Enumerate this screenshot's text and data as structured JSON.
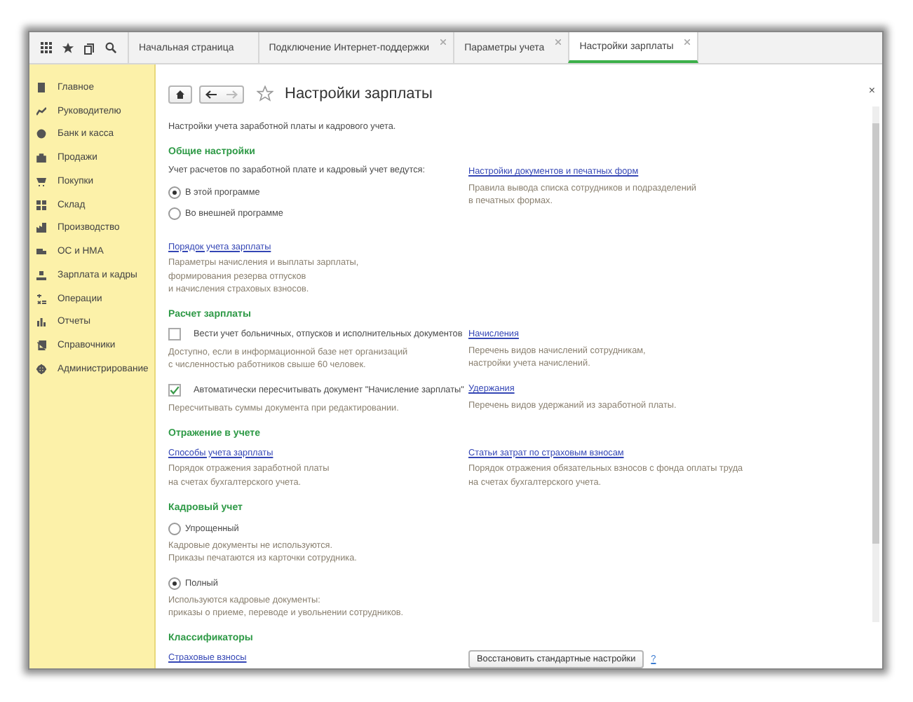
{
  "tabs": [
    {
      "label": "Начальная страница",
      "closable": false,
      "selected": false
    },
    {
      "label": "Подключение Интернет-поддержки",
      "closable": true,
      "selected": false
    },
    {
      "label": "Параметры учета",
      "closable": true,
      "selected": false
    },
    {
      "label": "Настройки зарплаты",
      "closable": true,
      "selected": true
    }
  ],
  "sidebar": {
    "items": [
      {
        "label": "Главное"
      },
      {
        "label": "Руководителю"
      },
      {
        "label": "Банк и касса"
      },
      {
        "label": "Продажи"
      },
      {
        "label": "Покупки"
      },
      {
        "label": "Склад"
      },
      {
        "label": "Производство"
      },
      {
        "label": "ОС и НМА"
      },
      {
        "label": "Зарплата и кадры"
      },
      {
        "label": "Операции"
      },
      {
        "label": "Отчеты"
      },
      {
        "label": "Справочники"
      },
      {
        "label": "Администрирование"
      }
    ]
  },
  "page": {
    "title": "Настройки зарплаты",
    "close": "×",
    "description": "Настройки учета заработной платы и кадрового учета.",
    "sections": [
      {
        "title": "Общие настройки",
        "left": [
          {
            "kind": "text",
            "text": "Учет расчетов по заработной плате и кадровый учет ведутся:"
          },
          {
            "kind": "radio",
            "label": "В этой программе",
            "selected": true
          },
          {
            "kind": "radio",
            "label": "Во внешней программе",
            "selected": false
          },
          {
            "kind": "link",
            "text": "Порядок учета зарплаты"
          },
          {
            "kind": "hint",
            "text": "Параметры начисления и выплаты зарплаты,\nформирования резерва отпусков\nи начисления страховых взносов."
          }
        ],
        "right": [
          {
            "kind": "link",
            "text": "Настройки документов и печатных форм"
          },
          {
            "kind": "hint",
            "text": "Правила вывода списка сотрудников и подразделений\nв печатных формах."
          }
        ]
      },
      {
        "title": "Расчет зарплаты",
        "left": [
          {
            "kind": "checkbox",
            "label": "Вести учет больничных, отпусков и исполнительных документов",
            "checked": false
          },
          {
            "kind": "hint",
            "text": "Доступно, если в информационной базе нет организаций\nс численностью работников свыше 60 человек."
          },
          {
            "kind": "checkbox",
            "label": "Автоматически пересчитывать документ \"Начисление зарплаты\"",
            "checked": true
          },
          {
            "kind": "hint",
            "text": "Пересчитывать суммы документа при редактировании."
          }
        ],
        "right": [
          {
            "kind": "link",
            "text": "Начисления"
          },
          {
            "kind": "hint",
            "text": "Перечень видов начислений сотрудникам,\nнастройки учета начислений."
          },
          {
            "kind": "link",
            "text": "Удержания"
          },
          {
            "kind": "hint",
            "text": "Перечень видов удержаний из заработной платы."
          }
        ]
      },
      {
        "title": "Отражение в учете",
        "left": [
          {
            "kind": "link",
            "text": "Способы учета зарплаты"
          },
          {
            "kind": "hint",
            "text": "Порядок отражения заработной платы\nна счетах бухгалтерского учета."
          }
        ],
        "right": [
          {
            "kind": "link",
            "text": "Статьи затрат по страховым взносам"
          },
          {
            "kind": "hint",
            "text": "Порядок отражения обязательных взносов с фонда оплаты труда\nна счетах бухгалтерского учета."
          }
        ]
      },
      {
        "title": "Кадровый учет",
        "left": [
          {
            "kind": "radio",
            "label": "Упрощенный",
            "selected": false
          },
          {
            "kind": "hint",
            "text": "Кадровые документы не используются.\nПриказы печатаются из карточки сотрудника."
          },
          {
            "kind": "radio",
            "label": "Полный",
            "selected": true
          },
          {
            "kind": "hint",
            "text": "Используются кадровые документы:\nприказы о приеме, переводе и увольнении сотрудников."
          }
        ]
      },
      {
        "title": "Классификаторы",
        "left": [
          {
            "kind": "link",
            "text": "Страховые взносы"
          }
        ],
        "right": [
          {
            "kind": "button",
            "label": "Восстановить стандартные настройки",
            "help": "?"
          }
        ]
      }
    ]
  }
}
